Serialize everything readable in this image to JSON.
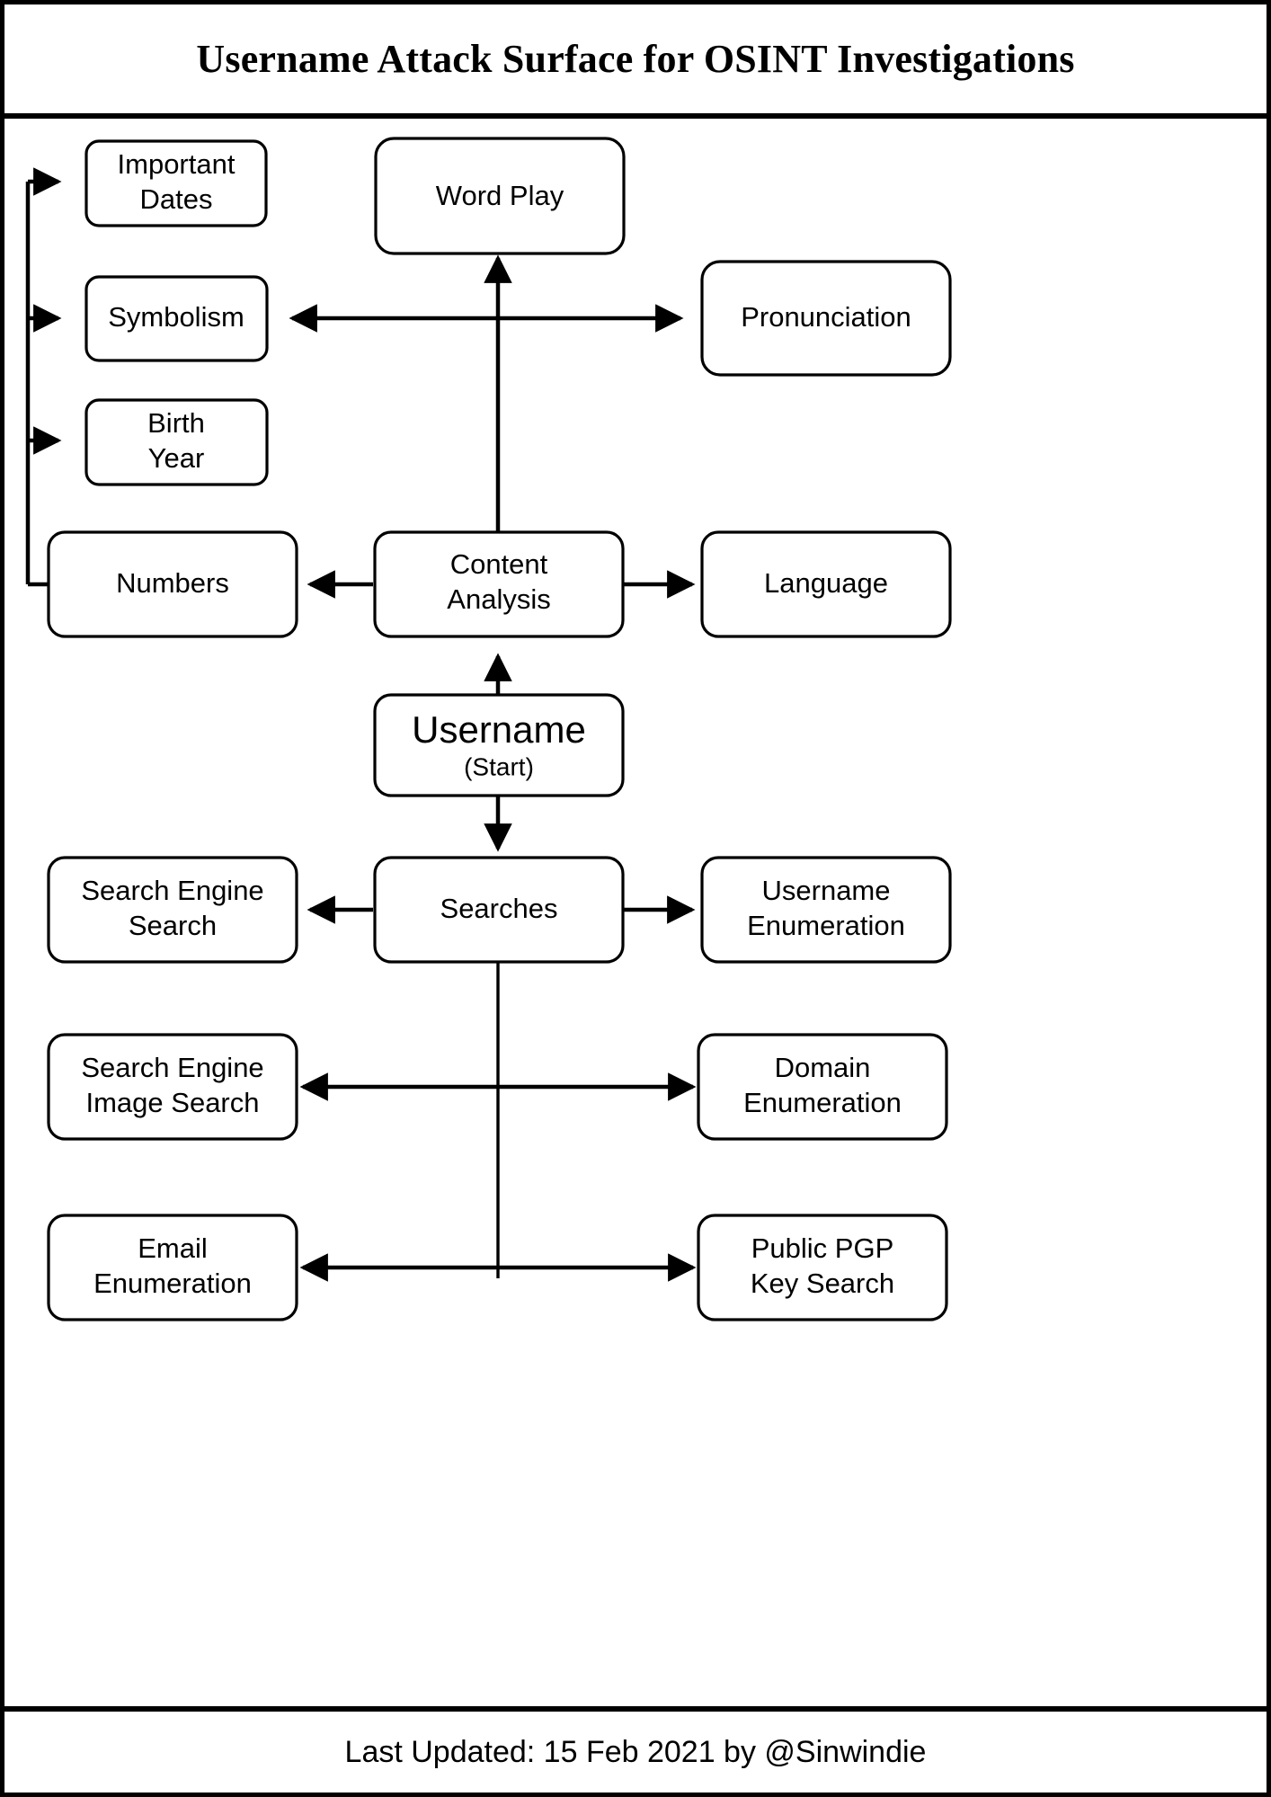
{
  "header": {
    "title": "Username Attack Surface for OSINT Investigations"
  },
  "footer": {
    "text": "Last Updated: 15 Feb 2021 by @Sinwindie"
  },
  "diagram": {
    "type": "flowchart",
    "nodes": {
      "important_dates": {
        "label_line1": "Important",
        "label_line2": "Dates"
      },
      "symbolism": {
        "label_line1": "Symbolism",
        "label_line2": ""
      },
      "birth_year": {
        "label_line1": "Birth",
        "label_line2": "Year"
      },
      "numbers": {
        "label_line1": "Numbers",
        "label_line2": ""
      },
      "word_play": {
        "label_line1": "Word Play",
        "label_line2": ""
      },
      "pronunciation": {
        "label_line1": "Pronunciation",
        "label_line2": ""
      },
      "content_analysis": {
        "label_line1": "Content",
        "label_line2": "Analysis"
      },
      "language": {
        "label_line1": "Language",
        "label_line2": ""
      },
      "username_start": {
        "label_line1": "Username",
        "label_line2": "(Start)"
      },
      "searches": {
        "label_line1": "Searches",
        "label_line2": ""
      },
      "search_engine_search": {
        "label_line1": "Search Engine",
        "label_line2": "Search"
      },
      "username_enumeration": {
        "label_line1": "Username",
        "label_line2": "Enumeration"
      },
      "search_engine_image_search": {
        "label_line1": "Search Engine",
        "label_line2": "Image Search"
      },
      "domain_enumeration": {
        "label_line1": "Domain",
        "label_line2": "Enumeration"
      },
      "email_enumeration": {
        "label_line1": "Email",
        "label_line2": "Enumeration"
      },
      "public_pgp_key_search": {
        "label_line1": "Public PGP",
        "label_line2": "Key Search"
      }
    },
    "edges": [
      {
        "from": "username_start",
        "to": "content_analysis",
        "style": "arrow-up"
      },
      {
        "from": "content_analysis",
        "to": "word_play",
        "style": "arrow-up"
      },
      {
        "from": "content_analysis",
        "to": "numbers",
        "style": "arrow-left"
      },
      {
        "from": "content_analysis",
        "to": "language",
        "style": "arrow-right"
      },
      {
        "from": "content_analysis",
        "to": "symbolism",
        "style": "arrow-left"
      },
      {
        "from": "content_analysis",
        "to": "pronunciation",
        "style": "arrow-right"
      },
      {
        "from": "numbers",
        "to": "important_dates",
        "style": "arrow-right"
      },
      {
        "from": "numbers",
        "to": "symbolism",
        "style": "arrow-right"
      },
      {
        "from": "numbers",
        "to": "birth_year",
        "style": "arrow-right"
      },
      {
        "from": "username_start",
        "to": "searches",
        "style": "arrow-down"
      },
      {
        "from": "searches",
        "to": "search_engine_search",
        "style": "arrow-left"
      },
      {
        "from": "searches",
        "to": "username_enumeration",
        "style": "arrow-right"
      },
      {
        "from": "searches",
        "to": "search_engine_image_search",
        "style": "arrow-left"
      },
      {
        "from": "searches",
        "to": "domain_enumeration",
        "style": "arrow-right"
      },
      {
        "from": "searches",
        "to": "email_enumeration",
        "style": "arrow-left"
      },
      {
        "from": "searches",
        "to": "public_pgp_key_search",
        "style": "arrow-right"
      }
    ]
  },
  "colors": {
    "stroke": "#000000",
    "fill": "#ffffff",
    "background": "#ffffff"
  }
}
